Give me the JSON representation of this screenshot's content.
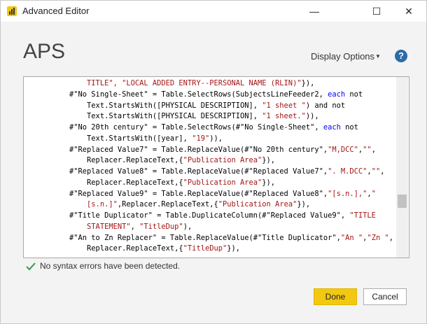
{
  "window": {
    "title": "Advanced Editor",
    "minimize_glyph": "—",
    "maximize_glyph": "☐",
    "close_glyph": "✕"
  },
  "header": {
    "query_name": "APS",
    "display_options_label": "Display Options",
    "help_glyph": "?"
  },
  "editor": {
    "lines": [
      [
        {
          "t": "        "
        },
        {
          "t": "TITLE\", \"LOCAL ADDED ENTRY--PERSONAL NAME (RLIN)\"",
          "c": "s"
        },
        {
          "t": "}),"
        }
      ],
      [
        {
          "t": "    #\"No Single-Sheet\" = Table.SelectRows(SubjectsLineFeeder2, "
        },
        {
          "t": "each",
          "c": "k"
        },
        {
          "t": " not"
        }
      ],
      [
        {
          "t": "        Text.StartsWith([PHYSICAL DESCRIPTION], "
        },
        {
          "t": "\"1 sheet \"",
          "c": "s"
        },
        {
          "t": ") and not"
        }
      ],
      [
        {
          "t": "        Text.StartsWith([PHYSICAL DESCRIPTION], "
        },
        {
          "t": "\"1 sheet.\"",
          "c": "s"
        },
        {
          "t": ")),"
        }
      ],
      [
        {
          "t": "    #\"No 20th century\" = Table.SelectRows(#\"No Single-Sheet\", "
        },
        {
          "t": "each",
          "c": "k"
        },
        {
          "t": " not"
        }
      ],
      [
        {
          "t": "        Text.StartsWith([year], "
        },
        {
          "t": "\"19\"",
          "c": "s"
        },
        {
          "t": ")),"
        }
      ],
      [
        {
          "t": "    #\"Replaced Value7\" = Table.ReplaceValue(#\"No 20th century\","
        },
        {
          "t": "\"M,DCC\"",
          "c": "s"
        },
        {
          "t": ","
        },
        {
          "t": "\"\"",
          "c": "s"
        },
        {
          "t": ","
        }
      ],
      [
        {
          "t": "        Replacer.ReplaceText,{"
        },
        {
          "t": "\"Publication Area\"",
          "c": "s"
        },
        {
          "t": "}),"
        }
      ],
      [
        {
          "t": "    #\"Replaced Value8\" = Table.ReplaceValue(#\"Replaced Value7\","
        },
        {
          "t": "\". M.DCC\"",
          "c": "s"
        },
        {
          "t": ","
        },
        {
          "t": "\"\"",
          "c": "s"
        },
        {
          "t": ","
        }
      ],
      [
        {
          "t": "        Replacer.ReplaceText,{"
        },
        {
          "t": "\"Publication Area\"",
          "c": "s"
        },
        {
          "t": "}),"
        }
      ],
      [
        {
          "t": "    #\"Replaced Value9\" = Table.ReplaceValue(#\"Replaced Value8\","
        },
        {
          "t": "\"[s.n.],\"",
          "c": "s"
        },
        {
          "t": ","
        },
        {
          "t": "\"",
          "c": "s"
        }
      ],
      [
        {
          "t": "        "
        },
        {
          "t": "[s.n.]\"",
          "c": "s"
        },
        {
          "t": ",Replacer.ReplaceText,{"
        },
        {
          "t": "\"Publication Area\"",
          "c": "s"
        },
        {
          "t": "}),"
        }
      ],
      [
        {
          "t": "    #\"Title Duplicator\" = Table.DuplicateColumn(#\"Replaced Value9\", "
        },
        {
          "t": "\"TITLE",
          "c": "s"
        }
      ],
      [
        {
          "t": "        "
        },
        {
          "t": "STATEMENT\"",
          "c": "s"
        },
        {
          "t": ", "
        },
        {
          "t": "\"TitleDup\"",
          "c": "s"
        },
        {
          "t": "),"
        }
      ],
      [
        {
          "t": "    #\"An to Zn Replacer\" = Table.ReplaceValue(#\"Title Duplicator\","
        },
        {
          "t": "\"An \"",
          "c": "s"
        },
        {
          "t": ","
        },
        {
          "t": "\"Zn \"",
          "c": "s"
        },
        {
          "t": ","
        }
      ],
      [
        {
          "t": "        Replacer.ReplaceText,{"
        },
        {
          "t": "\"TitleDup\"",
          "c": "s"
        },
        {
          "t": "}),"
        }
      ]
    ]
  },
  "status": {
    "message": "No syntax errors have been detected."
  },
  "buttons": {
    "done_label": "Done",
    "cancel_label": "Cancel"
  },
  "colors": {
    "accent": "#f2c811",
    "string": "#a31515",
    "keyword": "#0000ff",
    "check": "#2e9e4f"
  },
  "icons": {
    "app": "power-bi-icon",
    "help": "help-icon",
    "status": "check-icon",
    "dropdown": "caret-down-icon"
  }
}
